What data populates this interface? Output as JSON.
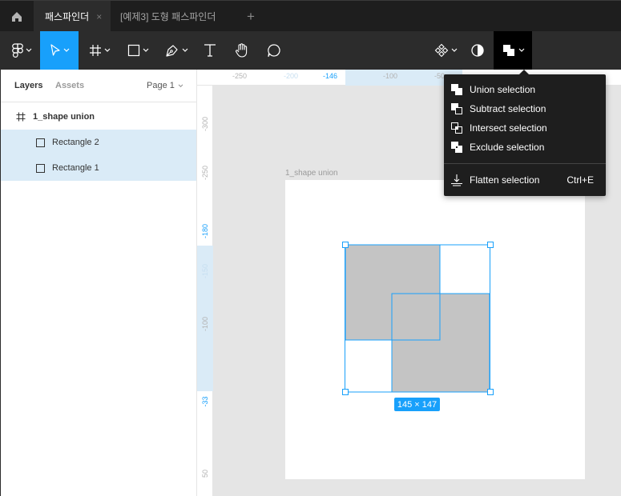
{
  "tabs": {
    "home_icon": "home-icon",
    "active_label": "패스파인더",
    "active_close": "×",
    "inactive_label": "[예제3] 도형 패스파인더",
    "new_tab": "+"
  },
  "toolbar": {
    "tools": [
      "figma-menu-icon",
      "move-tool-icon",
      "frame-tool-icon",
      "rectangle-tool-icon",
      "pen-tool-icon",
      "text-tool-icon",
      "hand-tool-icon",
      "comment-tool-icon"
    ],
    "right_tools": [
      "component-icon",
      "mask-icon",
      "boolean-operation-icon"
    ],
    "accent": "#18a0fb"
  },
  "left_panel": {
    "tab_layers": "Layers",
    "tab_assets": "Assets",
    "page_selector": "Page 1",
    "layers": [
      {
        "name": "1_shape union",
        "type": "frame"
      },
      {
        "name": "Rectangle 2",
        "type": "rectangle"
      },
      {
        "name": "Rectangle 1",
        "type": "rectangle"
      }
    ]
  },
  "rulers": {
    "top": [
      "-250",
      "-200",
      "-146",
      "-100",
      "-50"
    ],
    "left": [
      "-300",
      "-250",
      "-180",
      "-150",
      "-100",
      "-33",
      "50"
    ]
  },
  "canvas": {
    "frame_label": "1_shape union",
    "size_badge": "145 × 147"
  },
  "boolean_menu": {
    "items": [
      {
        "label": "Union selection",
        "icon": "union-icon"
      },
      {
        "label": "Subtract selection",
        "icon": "subtract-icon"
      },
      {
        "label": "Intersect selection",
        "icon": "intersect-icon"
      },
      {
        "label": "Exclude selection",
        "icon": "exclude-icon"
      }
    ],
    "flatten": {
      "label": "Flatten selection",
      "shortcut": "Ctrl+E",
      "icon": "flatten-icon"
    }
  }
}
